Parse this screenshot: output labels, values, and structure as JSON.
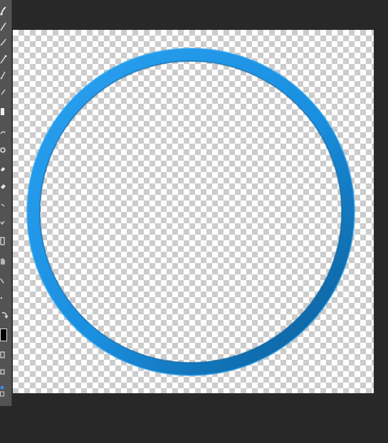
{
  "app": {
    "background": "#282828",
    "toolbar_color": "#535353"
  },
  "toolbar": {
    "tools": [
      {
        "name": "brush-tool-icon"
      },
      {
        "name": "pencil-tool-icon"
      },
      {
        "name": "smudge-tool-icon"
      },
      {
        "name": "eyedropper-tool-icon"
      },
      {
        "name": "pen-tool-icon"
      },
      {
        "name": "rectangle-select-icon"
      },
      {
        "name": "lasso-tool-icon"
      },
      {
        "name": "clone-stamp-icon"
      },
      {
        "name": "dodge-tool-icon"
      },
      {
        "name": "eraser-tool-icon"
      },
      {
        "name": "path-select-icon"
      },
      {
        "name": "type-tool-icon"
      },
      {
        "name": "shape-tool-icon"
      },
      {
        "name": "hand-tool-icon"
      },
      {
        "name": "zoom-tool-icon"
      },
      {
        "name": "rotate-view-icon"
      }
    ],
    "foreground_color": "#000000",
    "background_color": "#ffffff"
  },
  "canvas": {
    "transparent_background": true,
    "ring": {
      "color_outer": "#1a8fe0",
      "color_inner": "#0b5f97",
      "highlight": "#39a8ef"
    }
  }
}
